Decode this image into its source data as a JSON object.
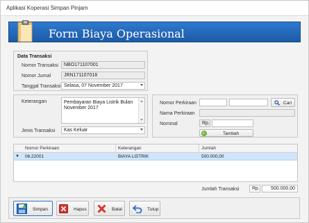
{
  "window": {
    "title": "Aplikasi Koperasi Simpan Pinjam"
  },
  "banner": {
    "title": "Form Biaya Operasional",
    "icon": "document-icon"
  },
  "transaction": {
    "section_title": "Data Transaksi",
    "number_label": "Nomor Transaksi",
    "number_value": "NBO171107001",
    "journal_label": "Nomor Jurnal",
    "journal_value": "JRN171107018",
    "date_label": "Tanggal Transaksi",
    "date_value": "Selasa, 07 November 2017"
  },
  "details": {
    "note_label": "Keterangan",
    "note_value": "Pembayaran Biaya Listrik Bulan November 2017",
    "type_label": "Jenis Transaksi",
    "type_value": "Kas Keluar"
  },
  "account": {
    "number_label": "Nomor Perkiraan",
    "number_value": "",
    "number_value2": "",
    "search_label": "Cari",
    "name_label": "Nama Perkiraan",
    "name_value": "",
    "nominal_label": "Nominal",
    "currency": "Rp.",
    "nominal_value": "",
    "add_label": "Tambah"
  },
  "table": {
    "columns": [
      "Nomor Perkiraan",
      "Keterangan",
      "Jumlah"
    ],
    "rows": [
      {
        "account": "06.22001",
        "description": "BIAYA LISTRIK",
        "amount": "500.000,00"
      }
    ]
  },
  "summary": {
    "label": "Jumlah Transaksi",
    "currency": "Rp.",
    "value": "500.000,00"
  },
  "actions": {
    "save": "Simpan",
    "delete": "Hapus",
    "cancel": "Batal",
    "close": "Tutup"
  },
  "colors": {
    "banner": "#1f63b4",
    "selected_row": "#cfe5fb",
    "save_border": "#2a73c9"
  }
}
